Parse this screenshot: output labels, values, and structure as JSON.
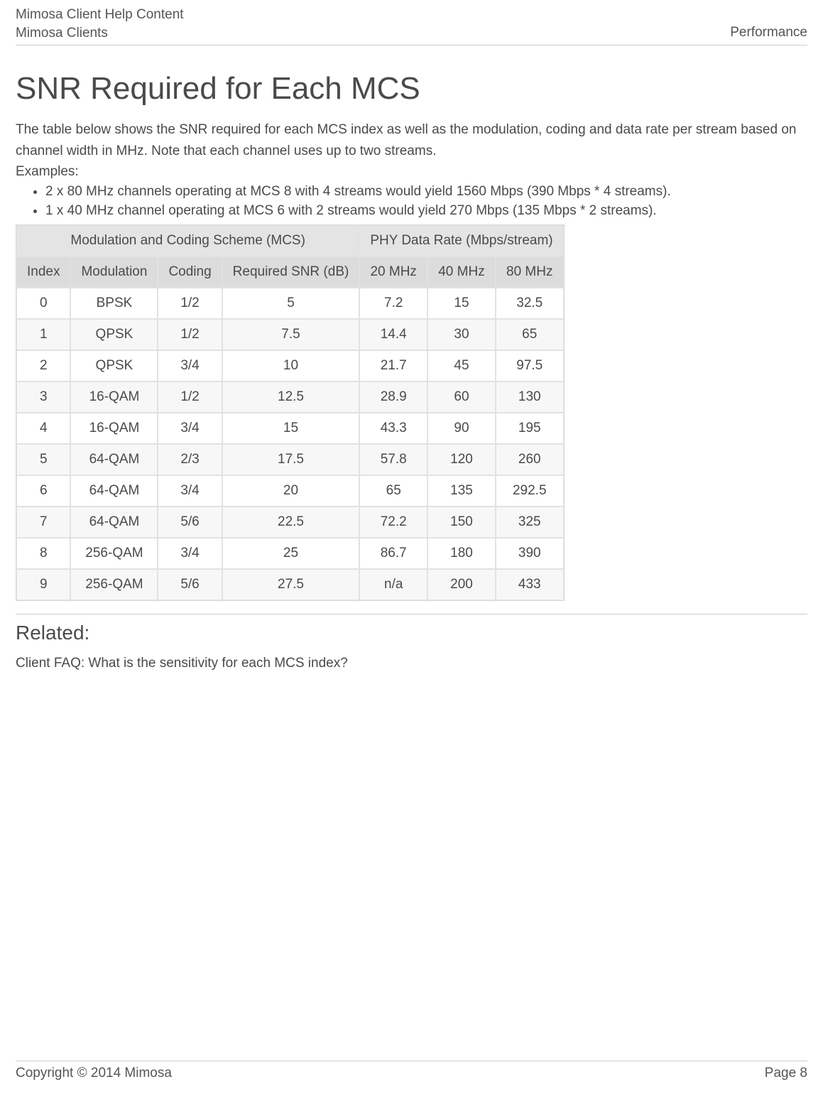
{
  "header": {
    "line1": "Mimosa Client Help Content",
    "line2": "Mimosa Clients",
    "right": "Performance"
  },
  "title": "SNR Required for Each MCS",
  "intro": "The table below shows the SNR required for each MCS index as well as the modulation, coding and data rate per stream based on channel width in MHz.  Note that each channel uses up to two streams.",
  "examples_label": "Examples:",
  "examples": [
    "2 x 80 MHz channels operating at MCS 8 with 4 streams would yield 1560 Mbps (390 Mbps * 4 streams).",
    "1 x 40 MHz channel operating at MCS 6 with 2 streams would yield 270 Mbps (135 Mbps * 2 streams)."
  ],
  "table": {
    "group_headers": [
      "Modulation and Coding Scheme (MCS)",
      "PHY Data Rate (Mbps/stream)"
    ],
    "col_headers": [
      "Index",
      "Modulation",
      "Coding",
      "Required SNR (dB)",
      "20 MHz",
      "40 MHz",
      "80 MHz"
    ],
    "rows": [
      [
        "0",
        "BPSK",
        "1/2",
        "5",
        "7.2",
        "15",
        "32.5"
      ],
      [
        "1",
        "QPSK",
        "1/2",
        "7.5",
        "14.4",
        "30",
        "65"
      ],
      [
        "2",
        "QPSK",
        "3/4",
        "10",
        "21.7",
        "45",
        "97.5"
      ],
      [
        "3",
        "16-QAM",
        "1/2",
        "12.5",
        "28.9",
        "60",
        "130"
      ],
      [
        "4",
        "16-QAM",
        "3/4",
        "15",
        "43.3",
        "90",
        "195"
      ],
      [
        "5",
        "64-QAM",
        "2/3",
        "17.5",
        "57.8",
        "120",
        "260"
      ],
      [
        "6",
        "64-QAM",
        "3/4",
        "20",
        "65",
        "135",
        "292.5"
      ],
      [
        "7",
        "64-QAM",
        "5/6",
        "22.5",
        "72.2",
        "150",
        "325"
      ],
      [
        "8",
        "256-QAM",
        "3/4",
        "25",
        "86.7",
        "180",
        "390"
      ],
      [
        "9",
        "256-QAM",
        "5/6",
        "27.5",
        "n/a",
        "200",
        "433"
      ]
    ]
  },
  "related_heading": "Related:",
  "related_link": "Client FAQ: What is the sensitivity for each MCS index?",
  "footer": {
    "left": "Copyright © 2014 Mimosa",
    "right": "Page 8"
  }
}
